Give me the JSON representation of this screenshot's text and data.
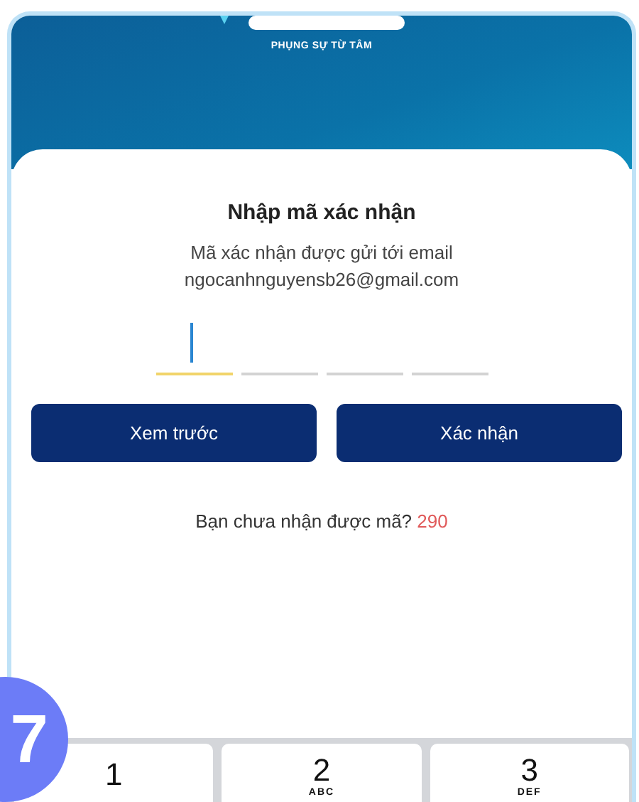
{
  "header": {
    "tagline": "PHỤNG SỰ TỪ TÂM"
  },
  "dialog": {
    "title": "Nhập mã xác nhận",
    "message": "Mã xác nhận được gửi tới email",
    "email": "ngocanhnguyensb26@gmail.com"
  },
  "code_slots": [
    {
      "selected": true
    },
    {
      "selected": false
    },
    {
      "selected": false
    },
    {
      "selected": false
    }
  ],
  "buttons": [
    "Xem trước",
    "Xác nhận"
  ],
  "resend": {
    "text": "Bạn chưa nhận được mã?",
    "countdown": "290"
  },
  "step_badge": "7",
  "keypad": [
    {
      "digit": "1"
    },
    {
      "digit": "2",
      "letters": "ABC"
    },
    {
      "digit": "3",
      "letters": "DEF"
    }
  ]
}
